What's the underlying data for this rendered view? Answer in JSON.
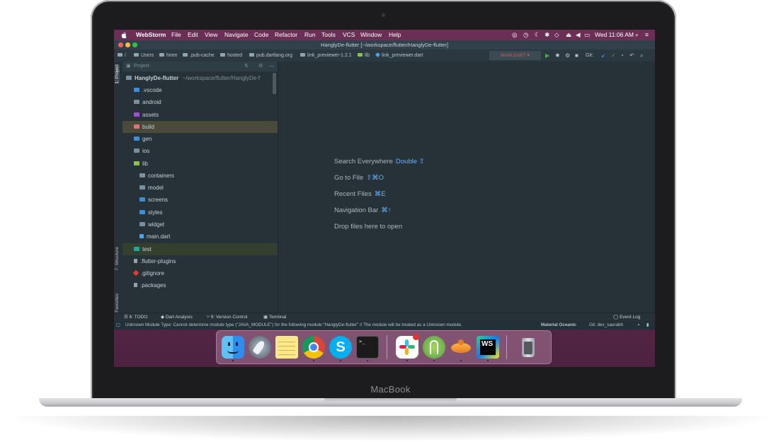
{
  "menubar": {
    "app_name": "WebStorm",
    "menus": [
      "File",
      "Edit",
      "View",
      "Navigate",
      "Code",
      "Refactor",
      "Run",
      "Tools",
      "VCS",
      "Window",
      "Help"
    ],
    "clock": "Wed 11:06 AM"
  },
  "window": {
    "title": "HanglyDe-flutter [~/workspace/flutter/HanglyDe-flutter]"
  },
  "breadcrumbs": [
    "/",
    "Users",
    "hiren",
    ".pub-cache",
    "hosted",
    "pub.dartlang.org",
    "link_previewer-1.2.1",
    "lib",
    "link_previewer.dart"
  ],
  "toolbar": {
    "run_config": "MAIN.DART",
    "git_label": "Git:"
  },
  "side_tabs": {
    "project": "1: Project",
    "structure": "7: Structure",
    "favorites": "2: Favorites"
  },
  "project_panel": {
    "header": "Project",
    "root_name": "HanglyDe-flutter",
    "root_path": "~/workspace/flutter/HanglyDe-f",
    "items": [
      {
        "label": ".vscode",
        "color": "#3c8fd6"
      },
      {
        "label": "android",
        "color": "#78909c"
      },
      {
        "label": "assets",
        "color": "#9c4fd6"
      },
      {
        "label": "build",
        "color": "#e0707a"
      },
      {
        "label": "gen",
        "color": "#3c8fd6"
      },
      {
        "label": "ios",
        "color": "#78909c"
      },
      {
        "label": "lib",
        "color": "#8bc34a"
      },
      {
        "label": "containers",
        "color": "#78909c"
      },
      {
        "label": "model",
        "color": "#78909c"
      },
      {
        "label": "screens",
        "color": "#3c8fd6"
      },
      {
        "label": "styles",
        "color": "#3c8fd6"
      },
      {
        "label": "widget",
        "color": "#78909c"
      },
      {
        "label": "main.dart",
        "color": "#42a5f5"
      },
      {
        "label": "test",
        "color": "#26a69a"
      },
      {
        "label": ".flutter-plugins",
        "color": "#90a4ae"
      },
      {
        "label": ".gitignore",
        "color": "#e53935"
      },
      {
        "label": ".packages",
        "color": "#90a4ae"
      }
    ]
  },
  "welcome": {
    "hints": [
      {
        "label": "Search Everywhere",
        "shortcut": "Double ⇧"
      },
      {
        "label": "Go to File",
        "shortcut": "⇧⌘O"
      },
      {
        "label": "Recent Files",
        "shortcut": "⌘E"
      },
      {
        "label": "Navigation Bar",
        "shortcut": "⌘↑"
      },
      {
        "label": "Drop files here to open",
        "shortcut": ""
      }
    ]
  },
  "bottom_tabs": [
    "6: TODO",
    "Dart Analysis",
    "9: Version Control",
    "Terminal",
    "Event Log"
  ],
  "status": {
    "message": "Unknown Module Type: Cannot determine module type (\"JAVA_MODULE\") for the following module:\"HanglyDe-flutter\" // The module will be treated as a Unknown module.",
    "theme": "Material Oceanic",
    "git_branch": "Git: dev_saurabh"
  },
  "dock": {
    "apps": [
      "finder-icon",
      "launchpad-icon",
      "notes-icon",
      "chrome-icon",
      "skype-icon",
      "terminal-icon",
      "slack-icon",
      "android-studio-icon",
      "transmit-icon",
      "webstorm-icon",
      "trash-icon"
    ],
    "webstorm_badge": "WS",
    "terminal_prompt": ">_"
  },
  "device": {
    "label": "MacBook"
  }
}
